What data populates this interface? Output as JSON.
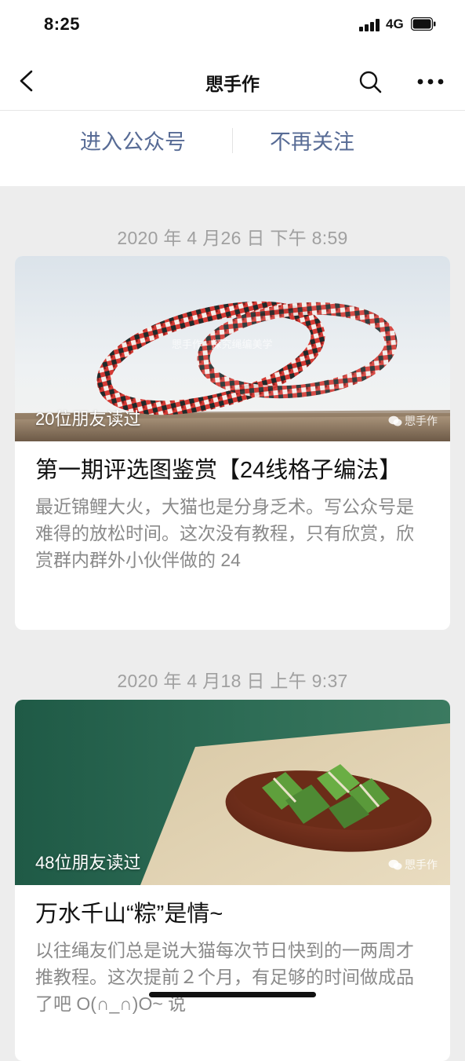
{
  "status": {
    "time": "8:25",
    "network": "4G"
  },
  "nav": {
    "title": "愳手作",
    "back_icon": "chevron-left-icon",
    "search_icon": "search-icon",
    "more_icon": "more-dots-icon"
  },
  "actions": {
    "enter_label": "进入公众号",
    "unfollow_label": "不再关注"
  },
  "colors": {
    "link": "#576b95",
    "background": "#ededed"
  },
  "articles": [
    {
      "date": "2020 年 4 月26 日 下午 8:59",
      "reads": "20位朋友读过",
      "brand": "愳手作",
      "watermark": "愳手作 · 探究绳编美学",
      "title": "第一期评选图鉴赏【24线格子编法】",
      "desc": "最近锦鲤大火，大猫也是分身乏术。写公众号是难得的放松时间。这次没有教程，只有欣赏，欣赏群内群外小伙伴做的 24"
    },
    {
      "date": "2020 年 4 月18 日 上午 9:37",
      "reads": "48位朋友读过",
      "brand": "愳手作",
      "title": "万水千山“粽”是情~",
      "desc": "以往绳友们总是说大猫每次节日快到的一两周才推教程。这次提前２个月，有足够的时间做成品了吧 O(∩_∩)O~ 说"
    }
  ]
}
